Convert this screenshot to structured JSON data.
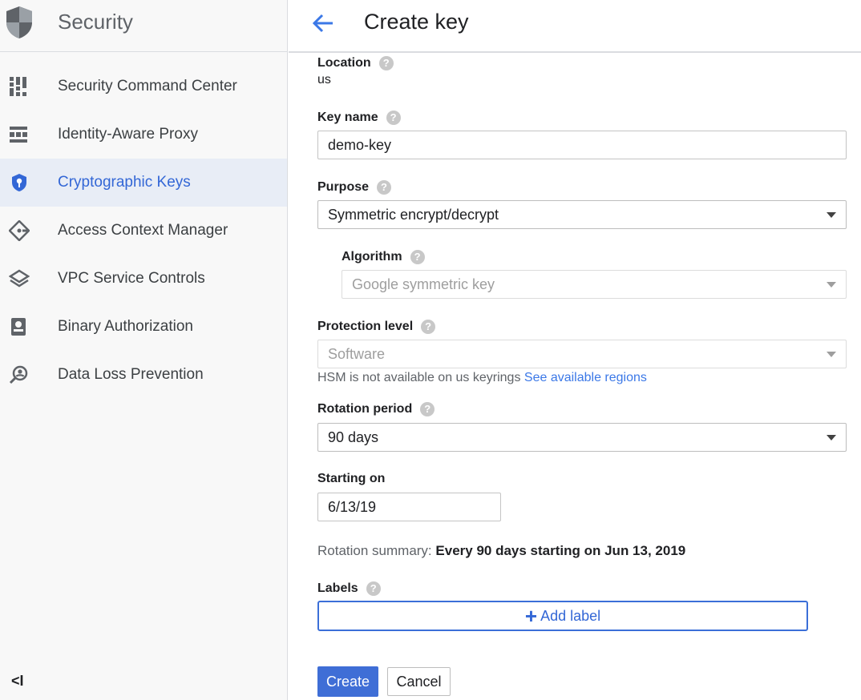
{
  "sidebar": {
    "title": "Security",
    "items": [
      {
        "label": "Security Command Center",
        "icon": "dashboard-grid-icon"
      },
      {
        "label": "Identity-Aware Proxy",
        "icon": "proxy-icon"
      },
      {
        "label": "Cryptographic Keys",
        "icon": "shield-key-icon",
        "active": true
      },
      {
        "label": "Access Context Manager",
        "icon": "diamond-icon"
      },
      {
        "label": "VPC Service Controls",
        "icon": "layers-icon"
      },
      {
        "label": "Binary Authorization",
        "icon": "badge-icon"
      },
      {
        "label": "Data Loss Prevention",
        "icon": "person-search-icon"
      }
    ],
    "collapse_label": "<I"
  },
  "header": {
    "title": "Create key"
  },
  "form": {
    "location": {
      "label": "Location",
      "value": "us"
    },
    "key_name": {
      "label": "Key name",
      "value": "demo-key"
    },
    "purpose": {
      "label": "Purpose",
      "value": "Symmetric encrypt/decrypt"
    },
    "algorithm": {
      "label": "Algorithm",
      "value": "Google symmetric key"
    },
    "protection_level": {
      "label": "Protection level",
      "value": "Software",
      "hint": "HSM is not available on us keyrings",
      "hint_link": "See available regions"
    },
    "rotation_period": {
      "label": "Rotation period",
      "value": "90 days"
    },
    "starting_on": {
      "label": "Starting on",
      "value": "6/13/19"
    },
    "rotation_summary": {
      "label": "Rotation summary:",
      "value": "Every 90 days starting on Jun 13, 2019"
    },
    "labels": {
      "label": "Labels",
      "add_label": "Add label"
    },
    "help_glyph": "?"
  },
  "actions": {
    "create": "Create",
    "cancel": "Cancel"
  },
  "colors": {
    "accent": "#3367d6",
    "active_bg": "#e8edf6",
    "primary_button": "#3f6ed6"
  }
}
